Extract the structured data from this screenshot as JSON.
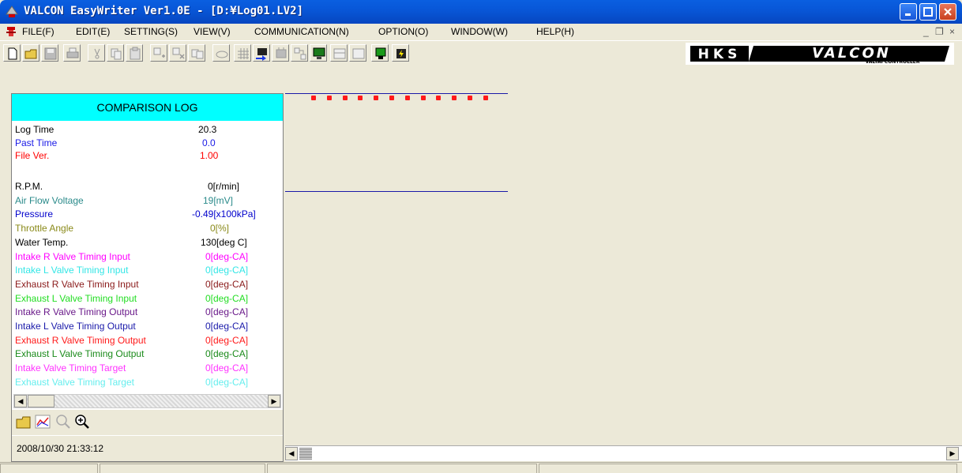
{
  "window": {
    "title": "VALCON EasyWriter Ver1.0E - [D:¥Log01.LV2]"
  },
  "menu": {
    "items": [
      "FILE(F)",
      "EDIT(E)",
      "SETTING(S)",
      "VIEW(V)",
      "COMMUNICATION(N)",
      "OPTION(O)",
      "WINDOW(W)",
      "HELP(H)"
    ],
    "mdi_min": "_",
    "mdi_restore": "❐",
    "mdi_close": "×"
  },
  "logo": {
    "brand": "HKS",
    "product": "VALCON",
    "tagline": "VALTAI CONTROLLER"
  },
  "panel": {
    "header": "COMPARISON LOG",
    "meta": [
      {
        "label": "Log Time",
        "value": "20.3",
        "color": "#000000"
      },
      {
        "label": "Past Time",
        "value": "0.0",
        "color": "#1a1ae6"
      },
      {
        "label": "File Ver.",
        "value": "1.00",
        "color": "#ff0000"
      }
    ],
    "params": [
      {
        "label": "R.P.M.",
        "value": "0[r/min]",
        "color": "#000000"
      },
      {
        "label": "Air Flow Voltage",
        "value": "19[mV]",
        "color": "#2a8a8a"
      },
      {
        "label": "Pressure",
        "value": "-0.49[x100kPa]",
        "color": "#0000cc"
      },
      {
        "label": "Throttle Angle",
        "value": "0[%]",
        "color": "#8a8a1a"
      },
      {
        "label": "Water Temp.",
        "value": "130[deg C]",
        "color": "#000000"
      },
      {
        "label": "Intake R Valve Timing Input",
        "value": "0[deg-CA]",
        "color": "#ff00ff"
      },
      {
        "label": "Intake L Valve Timing Input",
        "value": "0[deg-CA]",
        "color": "#33e6e6"
      },
      {
        "label": "Exhaust R Valve Timing Input",
        "value": "0[deg-CA]",
        "color": "#8a1a1a"
      },
      {
        "label": "Exhaust L Valve Timing Input",
        "value": "0[deg-CA]",
        "color": "#22dd22"
      },
      {
        "label": "Intake R Valve Timing Output",
        "value": "0[deg-CA]",
        "color": "#6a1a8a"
      },
      {
        "label": "Intake L Valve Timing Output",
        "value": "0[deg-CA]",
        "color": "#1a1aaa"
      },
      {
        "label": "Exhaust R Valve Timing Output",
        "value": "0[deg-CA]",
        "color": "#ff1a1a"
      },
      {
        "label": "Exhaust L Valve Timing Output",
        "value": "0[deg-CA]",
        "color": "#1a8a1a"
      },
      {
        "label": "Intake Valve Timing Target",
        "value": "0[deg-CA]",
        "color": "#ff33ff"
      },
      {
        "label": "Exhaust Valve Timing Target",
        "value": "0[deg-CA]",
        "color": "#66eeee"
      }
    ],
    "datetime": "2008/10/30   21:33:12"
  },
  "colors": {
    "title_bar": "#0857d8",
    "panel_header": "#00ffff",
    "graph_line": "#1a1aa8",
    "markers": "#ff1a1a"
  }
}
